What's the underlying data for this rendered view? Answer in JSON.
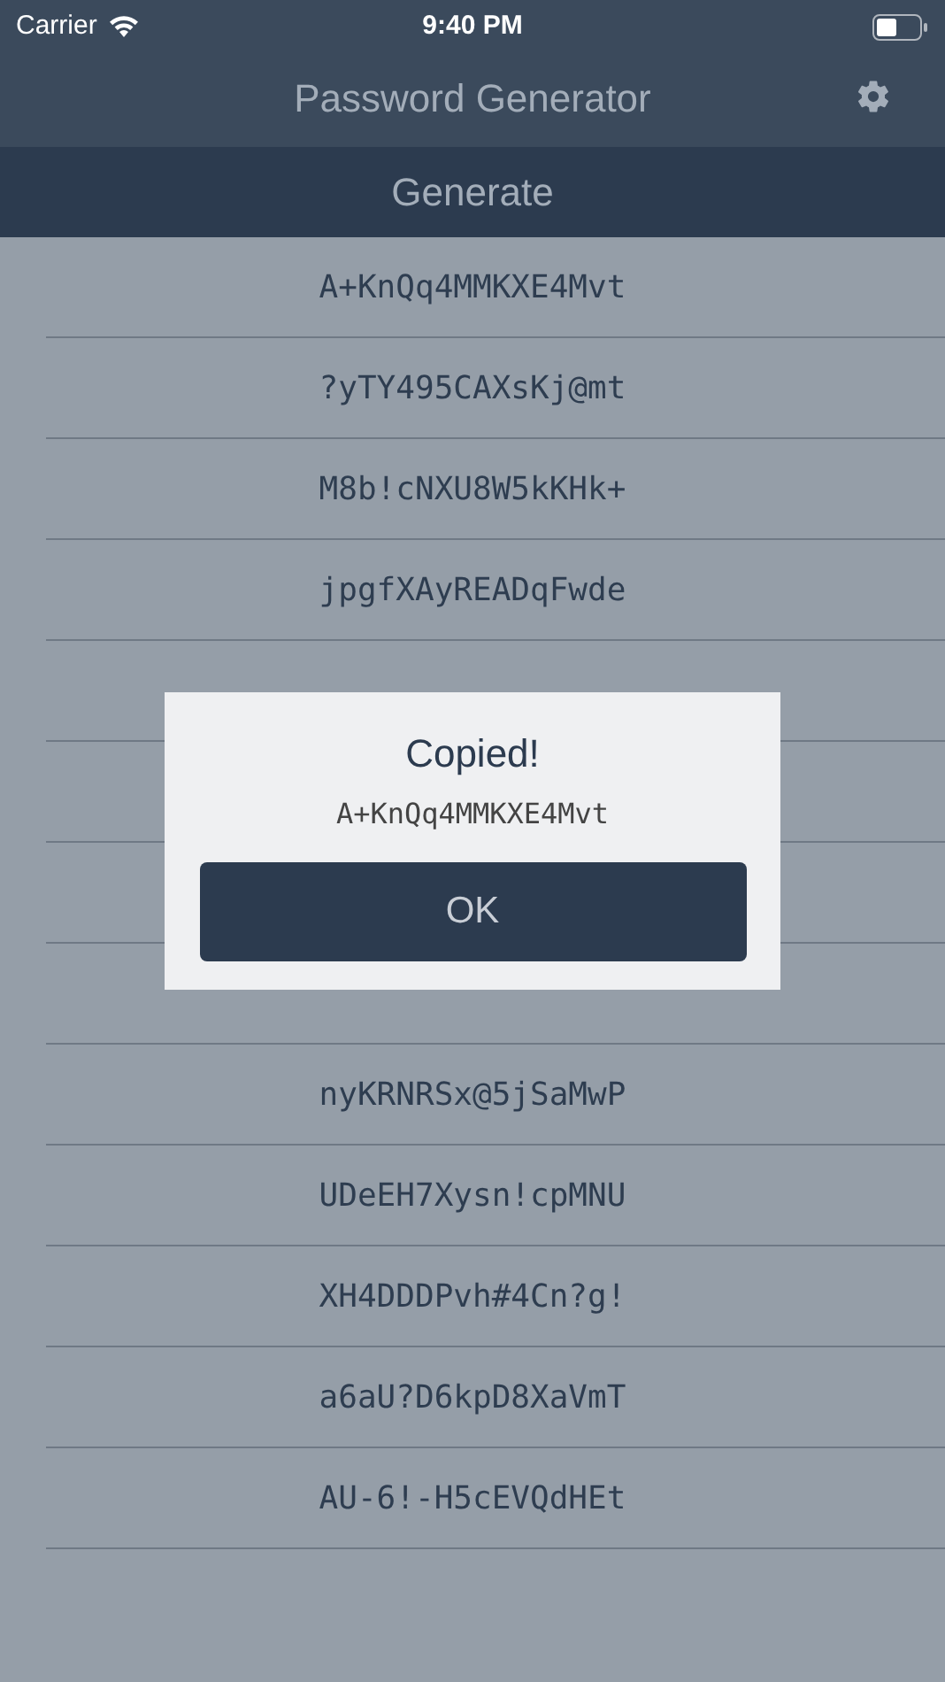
{
  "status_bar": {
    "carrier": "Carrier",
    "time": "9:40 PM"
  },
  "nav": {
    "title": "Password Generator"
  },
  "generate_button": "Generate",
  "rows_above_dialog": [
    "A+KnQq4MMKXE4Mvt",
    "?yTY495CAXsKj@mt",
    "M8b!cNXU8W5kKHk+",
    "jpgfXAyREADqFwde"
  ],
  "rows_below_dialog": [
    "nyKRNRSx@5jSaMwP",
    "UDeEH7Xysn!cpMNU",
    "XH4DDDPvh#4Cn?g!",
    "a6aU?D6kpD8XaVmT",
    "AU-6!-H5cEVQdHEt"
  ],
  "dialog": {
    "title": "Copied!",
    "message": "A+KnQq4MMKXE4Mvt",
    "button": "OK"
  }
}
